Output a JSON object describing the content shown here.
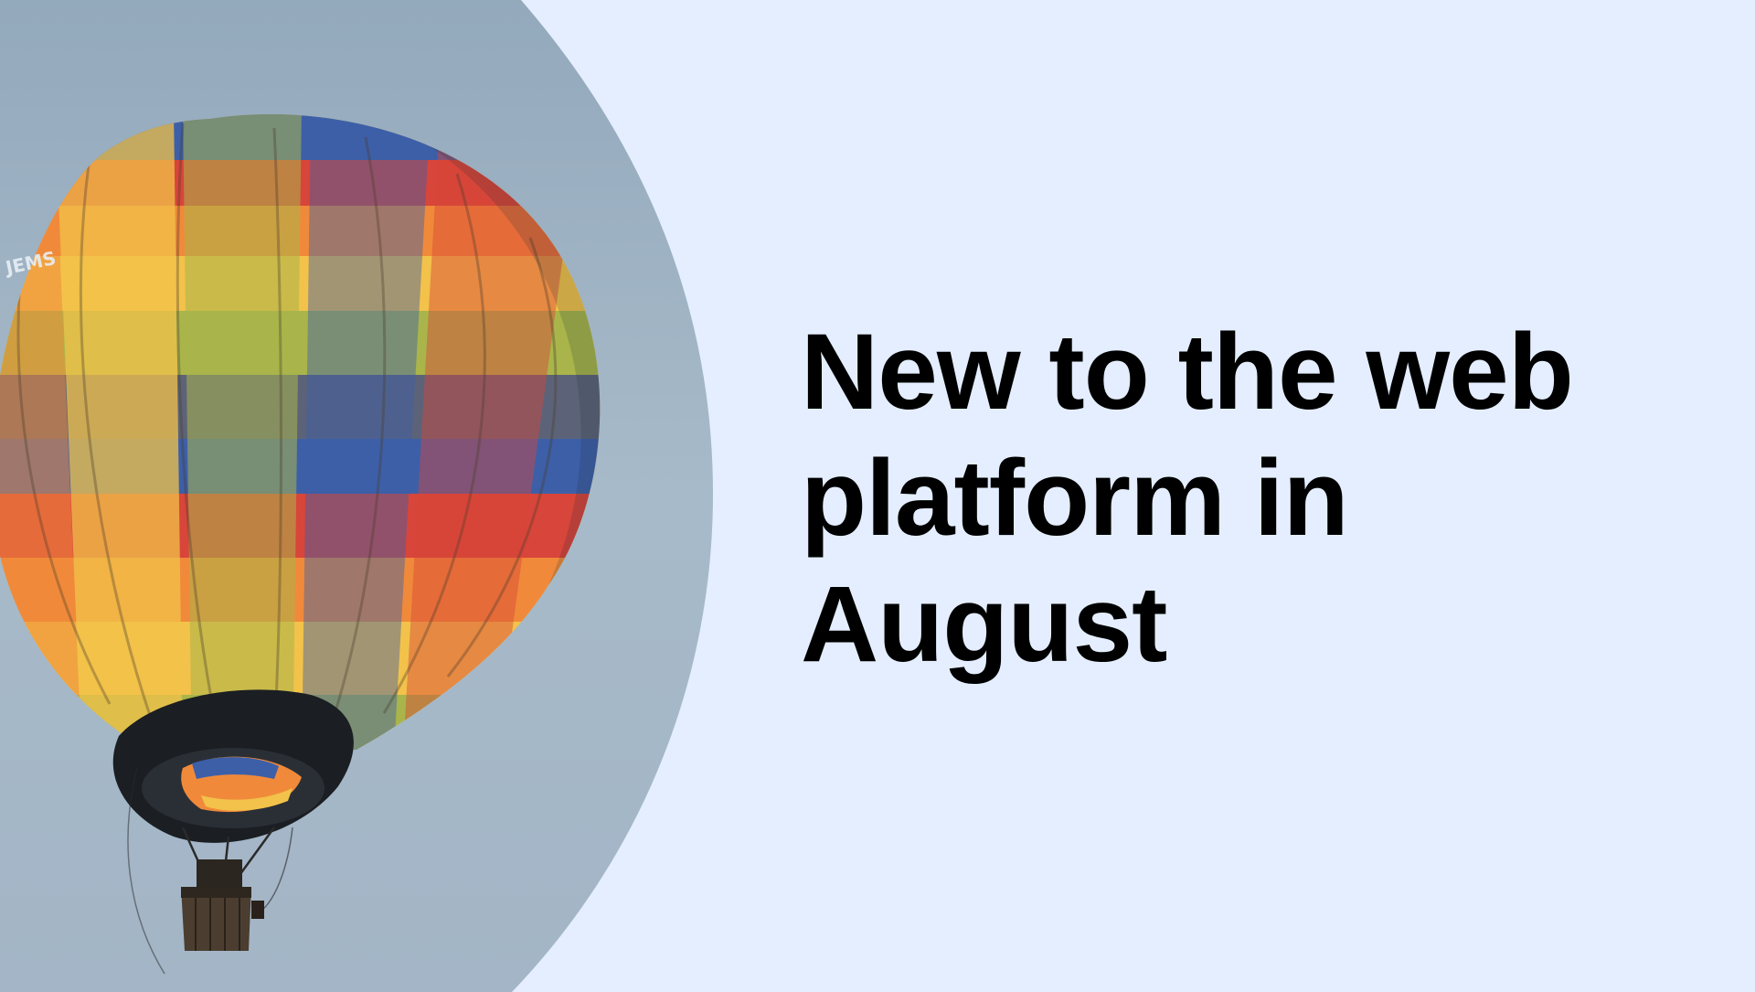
{
  "slide": {
    "headline": "New to the web platform in August",
    "balloon_marking": "JEMS"
  },
  "colors": {
    "background": "#e4eefe",
    "sky": "#9fb3c5",
    "headline_text": "#000000",
    "balloon_stripes": [
      "#3d5fa8",
      "#d8453a",
      "#f08a3a",
      "#f2c24a",
      "#a9b54a",
      "#6f8f5a",
      "#5c6378"
    ]
  },
  "icons": {
    "hero_image": "hot-air-balloon-illustration"
  }
}
